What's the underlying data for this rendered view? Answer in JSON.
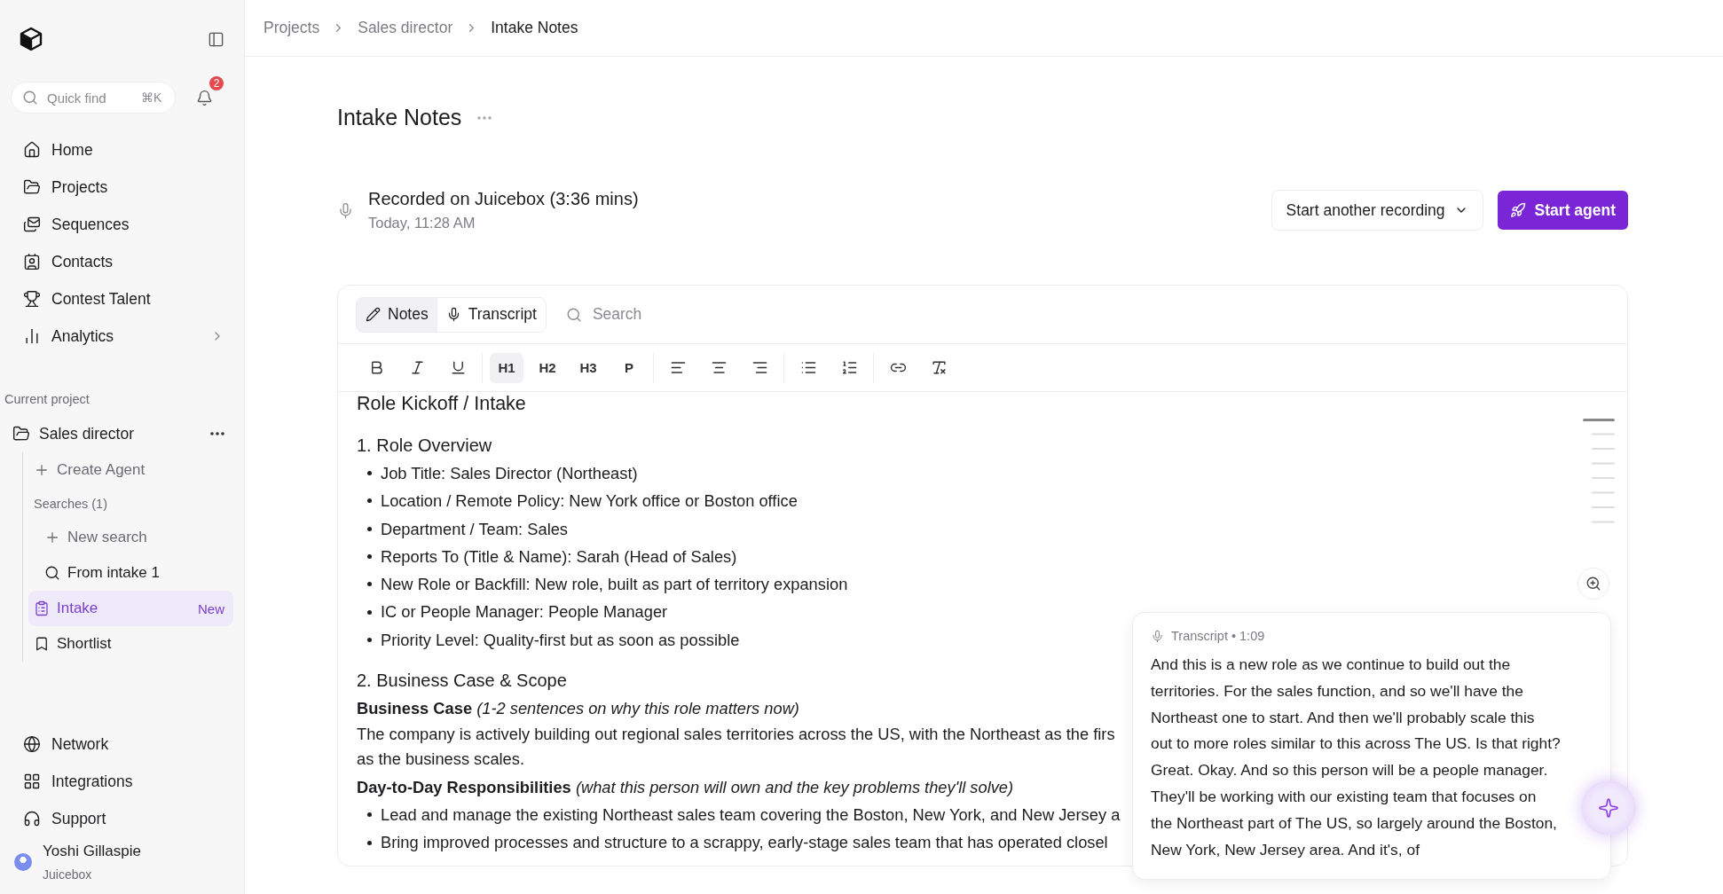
{
  "sidebar": {
    "quick_find": {
      "placeholder": "Quick find",
      "shortcut": "⌘K"
    },
    "notifications": {
      "count": "2"
    },
    "nav": [
      {
        "kind": "home",
        "label": "Home",
        "has_submenu": false
      },
      {
        "kind": "folder",
        "label": "Projects",
        "has_submenu": false
      },
      {
        "kind": "mails",
        "label": "Sequences",
        "has_submenu": false
      },
      {
        "kind": "contact",
        "label": "Contacts",
        "has_submenu": false
      },
      {
        "kind": "trophy",
        "label": "Contest Talent",
        "has_submenu": false
      },
      {
        "kind": "chart",
        "label": "Analytics",
        "has_submenu": true
      }
    ],
    "project": {
      "section_label": "Current project",
      "name": "Sales director",
      "items": [
        {
          "kind": "create",
          "label": "Create Agent",
          "selected": false
        },
        {
          "kind": "heading",
          "label": "Searches (1)",
          "selected": false,
          "children": [
            {
              "kind": "create",
              "label": "New search",
              "selected": false
            },
            {
              "kind": "search",
              "label": "From intake 1",
              "selected": false
            }
          ]
        },
        {
          "kind": "notes",
          "label": "Intake",
          "badge": "New",
          "selected": true
        },
        {
          "kind": "bookmark",
          "label": "Shortlist",
          "selected": false
        }
      ]
    },
    "footer_nav": [
      {
        "kind": "globe",
        "label": "Network"
      },
      {
        "kind": "grid",
        "label": "Integrations"
      },
      {
        "kind": "headphones",
        "label": "Support"
      }
    ],
    "user": {
      "name": "Yoshi Gillaspie",
      "org": "Juicebox"
    }
  },
  "breadcrumb": [
    {
      "label": "Projects",
      "current": false
    },
    {
      "label": "Sales director",
      "current": false
    },
    {
      "label": "Intake Notes",
      "current": true
    }
  ],
  "page": {
    "title": "Intake Notes",
    "recording": {
      "title": "Recorded on Juicebox (3:36 mins)",
      "time": "Today, 11:28 AM"
    },
    "buttons": [
      {
        "kind": "dropdown",
        "label": "Start another recording"
      },
      {
        "kind": "primary",
        "label": "Start agent"
      }
    ]
  },
  "editor": {
    "tabs": [
      {
        "kind": "notes",
        "label": "Notes",
        "selected": true
      },
      {
        "kind": "transcript",
        "label": "Transcript",
        "selected": false
      }
    ],
    "search": {
      "placeholder": "Search"
    },
    "toolbar": [
      [
        {
          "kind": "bold"
        },
        {
          "kind": "italic"
        },
        {
          "kind": "underline"
        }
      ],
      [
        {
          "kind": "text",
          "label": "H1",
          "selected": true
        },
        {
          "kind": "text",
          "label": "H2",
          "selected": false
        },
        {
          "kind": "text",
          "label": "H3",
          "selected": false
        },
        {
          "kind": "text",
          "label": "P",
          "selected": false
        }
      ],
      [
        {
          "kind": "align-left"
        },
        {
          "kind": "align-center"
        },
        {
          "kind": "align-right"
        }
      ],
      [
        {
          "kind": "bullet-list"
        },
        {
          "kind": "numbered-list"
        }
      ],
      [
        {
          "kind": "link"
        },
        {
          "kind": "clear-format"
        }
      ]
    ],
    "document": [
      {
        "kind": "title",
        "text": "Role Kickoff / Intake"
      },
      {
        "kind": "heading",
        "text": "1. Role Overview"
      },
      {
        "kind": "bullets",
        "items": [
          "Job Title: Sales Director (Northeast)",
          "Location / Remote Policy: New York office or Boston office",
          "Department / Team: Sales",
          "Reports To (Title & Name): Sarah (Head of Sales)",
          "New Role or Backfill: New role, built as part of territory expansion",
          "IC or People Manager: People Manager",
          "Priority Level: Quality-first but as soon as possible"
        ]
      },
      {
        "kind": "heading",
        "text": "2. Business Case & Scope"
      },
      {
        "kind": "label",
        "text": "**Business Case** *(1-2 sentences on why this role matters now)*"
      },
      {
        "kind": "paragraph",
        "lines": [
          "The company is actively building out regional sales territories across the US, with the Northeast as the firs",
          "as the business scales."
        ]
      },
      {
        "kind": "label",
        "text": "**Day-to-Day Responsibilities** *(what this person will own and the key problems they'll solve)*"
      },
      {
        "kind": "bullets",
        "items": [
          "Lead and manage the existing Northeast sales team covering the Boston, New York, and New Jersey a",
          "Bring improved processes and structure to a scrappy, early-stage sales team that has operated closel"
        ]
      }
    ],
    "transcript_popup": {
      "label": "Transcript • 1:09",
      "lines": [
        "And this is a new role as we continue to build out the",
        "territories. For the sales function, and so we'll have the",
        "Northeast one to start. And then we'll probably scale this",
        "out to more roles similar to this across The US. Is that right?",
        "Great. Okay. And so this person will be a people manager.",
        "They'll be working with our existing team that focuses on",
        "the Northeast part of The US, so largely around the Boston,",
        "New York, New Jersey area. And it's, of"
      ]
    }
  }
}
